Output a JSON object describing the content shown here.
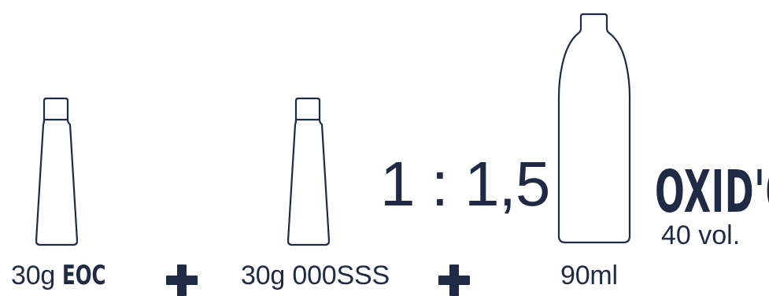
{
  "items": [
    {
      "amount": "30g",
      "product": "EOC"
    },
    {
      "amount": "30g",
      "product": "000SSS"
    },
    {
      "amount": "90ml"
    }
  ],
  "ratio": "1 : 1,5",
  "developer": {
    "name": "OXID'O",
    "strength": "40 vol."
  },
  "colors": {
    "ink": "#1f2a44",
    "background": "#ffffff"
  },
  "icons": [
    "tube-icon",
    "tube-icon",
    "bottle-icon",
    "plus-icon",
    "plus-icon"
  ]
}
